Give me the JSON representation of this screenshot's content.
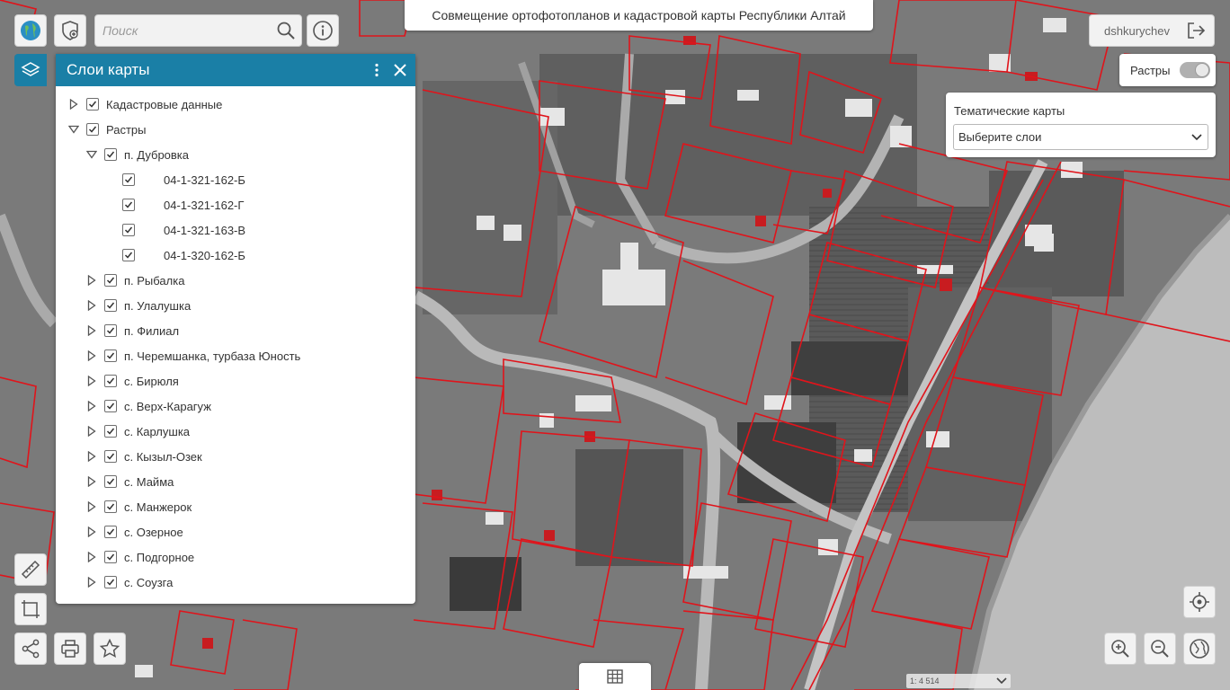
{
  "header": {
    "title": "Совмещение ортофотопланов и кадастровой карты Республики Алтай"
  },
  "search": {
    "placeholder": "Поиск"
  },
  "user": {
    "name": "dshkurychev"
  },
  "layers_panel": {
    "title": "Слои карты",
    "items": [
      {
        "label": "Кадастровые данные",
        "level": 0,
        "expanded": false,
        "checked": true
      },
      {
        "label": "Растры",
        "level": 0,
        "expanded": true,
        "checked": true
      },
      {
        "label": "п. Дубровка",
        "level": 1,
        "expanded": true,
        "checked": true
      },
      {
        "label": "04-1-321-162-Б",
        "level": 2,
        "checked": true
      },
      {
        "label": "04-1-321-162-Г",
        "level": 2,
        "checked": true
      },
      {
        "label": "04-1-321-163-В",
        "level": 2,
        "checked": true
      },
      {
        "label": "04-1-320-162-Б",
        "level": 2,
        "checked": true
      },
      {
        "label": "п. Рыбалка",
        "level": 1,
        "expanded": false,
        "checked": true
      },
      {
        "label": "п. Улалушка",
        "level": 1,
        "expanded": false,
        "checked": true
      },
      {
        "label": "п. Филиал",
        "level": 1,
        "expanded": false,
        "checked": true
      },
      {
        "label": "п. Черемшанка, турбаза Юность",
        "level": 1,
        "expanded": false,
        "checked": true
      },
      {
        "label": "с. Бирюля",
        "level": 1,
        "expanded": false,
        "checked": true
      },
      {
        "label": "с. Верх-Карагуж",
        "level": 1,
        "expanded": false,
        "checked": true
      },
      {
        "label": "с. Карлушка",
        "level": 1,
        "expanded": false,
        "checked": true
      },
      {
        "label": "с. Кызыл-Озек",
        "level": 1,
        "expanded": false,
        "checked": true
      },
      {
        "label": "с. Майма",
        "level": 1,
        "expanded": false,
        "checked": true
      },
      {
        "label": "с. Манжерок",
        "level": 1,
        "expanded": false,
        "checked": true
      },
      {
        "label": "с. Озерное",
        "level": 1,
        "expanded": false,
        "checked": true
      },
      {
        "label": "с. Подгорное",
        "level": 1,
        "expanded": false,
        "checked": true
      },
      {
        "label": "с. Соузга",
        "level": 1,
        "expanded": false,
        "checked": true
      }
    ]
  },
  "rasters_toggle": {
    "label": "Растры",
    "on": false
  },
  "thematic": {
    "label": "Тематические карты",
    "select_value": "Выберите слои"
  },
  "scale": {
    "text": "1: 4 514"
  },
  "colors": {
    "accent": "#1a7fa6",
    "parcel_lines": "#e0141b"
  },
  "icons": [
    "globe-icon",
    "add-layer-icon",
    "search-icon",
    "info-icon",
    "logout-icon",
    "layers-icon",
    "more-vert-icon",
    "close-icon",
    "ruler-icon",
    "area-measure-icon",
    "share-icon",
    "print-icon",
    "star-icon",
    "grid-table-icon",
    "locate-icon",
    "zoom-in-icon",
    "zoom-out-icon",
    "world-icon"
  ]
}
